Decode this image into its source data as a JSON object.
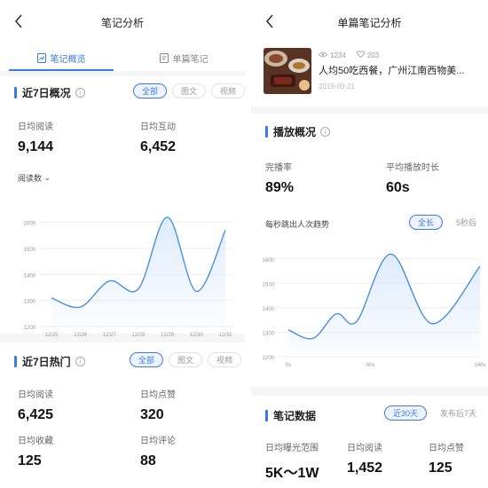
{
  "left": {
    "nav_title": "笔记分析",
    "tabs": [
      {
        "label": "笔记概览",
        "active": true
      },
      {
        "label": "单篇笔记",
        "active": false
      }
    ],
    "overview": {
      "title": "近7日概况",
      "filters": [
        "全部",
        "图文",
        "视频"
      ],
      "metrics": [
        {
          "label": "日均阅读",
          "value": "9,144"
        },
        {
          "label": "日均互动",
          "value": "6,452"
        }
      ],
      "chart_selector": "阅读数"
    },
    "hot": {
      "title": "近7日热门",
      "filters": [
        "全部",
        "图文",
        "视频"
      ],
      "metrics": [
        {
          "label": "日均阅读",
          "value": "6,425"
        },
        {
          "label": "日均点赞",
          "value": "320"
        },
        {
          "label": "日均收藏",
          "value": "125"
        },
        {
          "label": "日均评论",
          "value": "88"
        }
      ]
    }
  },
  "right": {
    "nav_title": "单篇笔记分析",
    "note": {
      "views": "1234",
      "likes": "203",
      "title": "人均50吃西餐，广州江南西物美...",
      "date": "2019-09-21"
    },
    "playback": {
      "title": "播放概况",
      "metrics": [
        {
          "label": "完播率",
          "value": "89%"
        },
        {
          "label": "平均播放时长",
          "value": "60s"
        }
      ],
      "chart_label": "每秒跳出人次趋势",
      "filters": [
        "全长",
        "5秒后"
      ]
    },
    "note_data": {
      "title": "笔记数据",
      "filters": [
        "近30天",
        "发布后7天"
      ],
      "metrics": [
        {
          "label": "日均曝光范围",
          "value": "5K～1W"
        },
        {
          "label": "日均阅读",
          "value": "1,452"
        },
        {
          "label": "日均点赞",
          "value": "125"
        }
      ]
    }
  },
  "colors": {
    "accent": "#3b7be9",
    "line": "#4a90e2",
    "fill": "#dbe9fb"
  },
  "chart_data": [
    {
      "type": "area",
      "title": "",
      "xlabel": "",
      "ylabel": "",
      "x": [
        "12/25",
        "12/26",
        "12/27",
        "12/28",
        "12/29",
        "12/30",
        "12/31"
      ],
      "yticks": [
        1200,
        1300,
        1400,
        1500,
        1600
      ],
      "ylim": [
        1200,
        1650
      ],
      "series": [
        {
          "values": [
            1310,
            1275,
            1375,
            1345,
            1620,
            1335,
            1570
          ]
        }
      ],
      "grid": true
    },
    {
      "type": "area",
      "title": "",
      "xlabel": "",
      "ylabel": "",
      "x": [
        "0s",
        "60s",
        "140s"
      ],
      "x_values": [
        0,
        60,
        140
      ],
      "yticks": [
        1200,
        1300,
        1400,
        1500,
        1600
      ],
      "ylim": [
        1200,
        1650
      ],
      "series": [
        {
          "points": [
            [
              0,
              1310
            ],
            [
              18,
              1275
            ],
            [
              35,
              1375
            ],
            [
              50,
              1345
            ],
            [
              75,
              1620
            ],
            [
              105,
              1335
            ],
            [
              140,
              1570
            ]
          ]
        }
      ],
      "grid": true
    }
  ]
}
